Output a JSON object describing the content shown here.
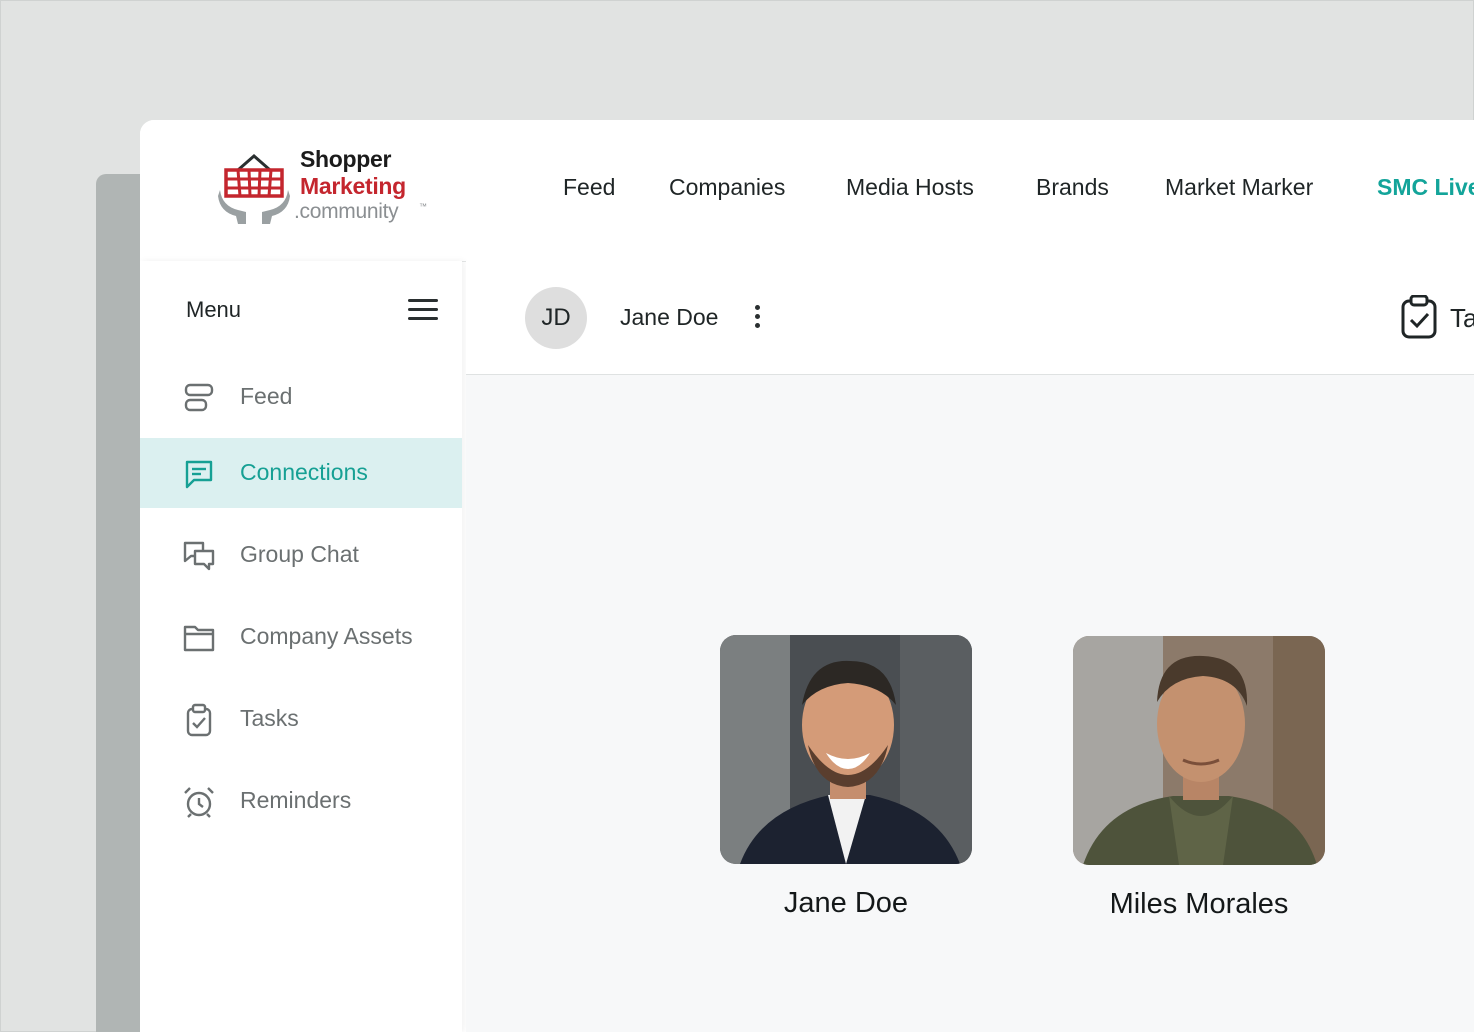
{
  "logo": {
    "line1": "Shopper",
    "line2": "Marketing",
    "line3": ".community",
    "trademark": "™"
  },
  "nav": {
    "items": [
      {
        "label": "Feed"
      },
      {
        "label": "Companies"
      },
      {
        "label": "Media Hosts"
      },
      {
        "label": "Brands"
      },
      {
        "label": "Market Marker"
      },
      {
        "label": "SMC Live"
      }
    ],
    "active_color": "#13a49a"
  },
  "sidebar": {
    "title": "Menu",
    "items": [
      {
        "label": "Feed",
        "icon": "feed-icon"
      },
      {
        "label": "Connections",
        "icon": "message-icon",
        "active": true
      },
      {
        "label": "Group Chat",
        "icon": "group-chat-icon"
      },
      {
        "label": "Company Assets",
        "icon": "folder-icon"
      },
      {
        "label": "Tasks",
        "icon": "clipboard-check-icon"
      },
      {
        "label": "Reminders",
        "icon": "alarm-clock-icon"
      }
    ]
  },
  "conversation": {
    "avatar_initials": "JD",
    "name": "Jane Doe",
    "tasks_label": "Ta"
  },
  "connections": [
    {
      "name": "Jane Doe"
    },
    {
      "name": "Miles Morales"
    }
  ],
  "colors": {
    "accent": "#16a094",
    "brand_red": "#c4262e",
    "active_bg": "#dbf0f0"
  }
}
